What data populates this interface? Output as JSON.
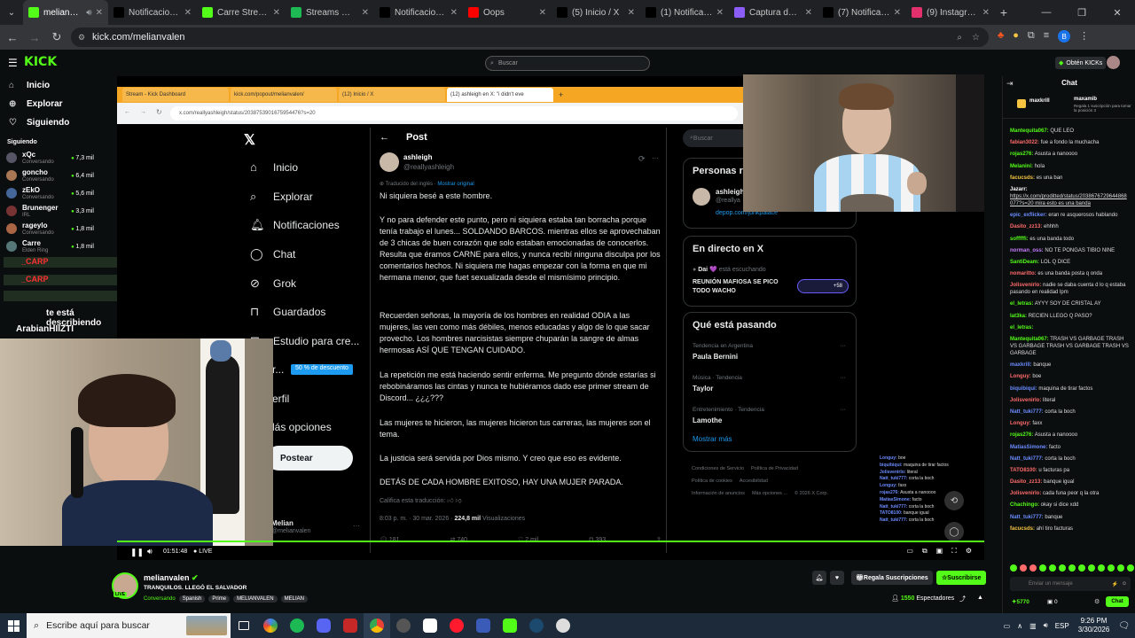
{
  "browser": {
    "tabs": [
      {
        "label": "melianvalen",
        "color": "#53fc18",
        "active": true
      },
      {
        "label": "Notificaciones",
        "color": "#000000"
      },
      {
        "label": "Carre Stream -",
        "color": "#53fc18"
      },
      {
        "label": "Streams — MC",
        "color": "#1db954"
      },
      {
        "label": "Notificaciones",
        "color": "#000000"
      },
      {
        "label": "Oops",
        "color": "#ff0000"
      },
      {
        "label": "(5) Inicio / X",
        "color": "#000000"
      },
      {
        "label": "(1) Notificacion",
        "color": "#000000"
      },
      {
        "label": "Captura de pa",
        "color": "#8b5cf6"
      },
      {
        "label": "(7) Notificacion",
        "color": "#000000"
      },
      {
        "label": "(9) Instagram",
        "color": "#e1306c"
      }
    ],
    "url": "kick.com/melianvalen"
  },
  "kick": {
    "search_placeholder": "Buscar",
    "obtain_kicks": "Obtén KICKs",
    "nav": [
      {
        "label": "Inicio",
        "icon": "home-icon"
      },
      {
        "label": "Explorar",
        "icon": "compass-icon"
      },
      {
        "label": "Siguiendo",
        "icon": "heart-icon"
      }
    ],
    "following_header": "Siguiendo",
    "following": [
      {
        "name": "xQc",
        "game": "Conversando",
        "viewers": "7,3 mil"
      },
      {
        "name": "goncho",
        "game": "Conversando",
        "viewers": "6,4 mil"
      },
      {
        "name": "zEkO",
        "game": "Conversando",
        "viewers": "5,6 mil"
      },
      {
        "name": "Brunenger",
        "game": "IRL",
        "viewers": "3,3 mil"
      },
      {
        "name": "rageylo",
        "game": "Conversando",
        "viewers": "1,8 mil"
      },
      {
        "name": "Carre",
        "game": "Elden Ring",
        "viewers": "1,8 mil"
      }
    ]
  },
  "overlay": {
    "alerts": [
      "_CARP",
      "_CARP"
    ],
    "line1": "te está describiendo",
    "line2": "ArabianHIIZTI"
  },
  "inner_browser": {
    "tabs": [
      "Stream - Kick Dashboard",
      "kick.com/popout/melianvalen/",
      "(12) Inicio / X",
      "(12) ashleigh en X: \"i didn't eve"
    ],
    "url": "x.com/reallyashleigh/status/2038753901675954476?s=20"
  },
  "x_nav": [
    "Inicio",
    "Explorar",
    "Notificaciones",
    "Chat",
    "Grok",
    "Guardados",
    "Estudio para cre...",
    "r...",
    "erfil",
    "lás opciones"
  ],
  "x_premium_badge": "50 % de descuento",
  "x_post_button": "Postear",
  "x_account": {
    "name": "Melian",
    "handle": "@melianvalen"
  },
  "post": {
    "header": "Post",
    "author_name": "ashleigh",
    "author_handle": "@reallyashleigh",
    "translated": "Traducido del inglés",
    "show_original": "Mostrar original",
    "paragraphs": [
      "Ni siquiera besé a este hombre.",
      "Y no para defender este punto, pero ni siquiera estaba tan borracha porque tenía trabajo el lunes... SOLDANDO BARCOS. mientras ellos se aprovechaban de 3 chicas de buen corazón que solo estaban emocionadas de conocerlos. Resulta que éramos CARNE para ellos, y nunca recibí ninguna disculpa por los comentarios hechos. Ni siquiera me hagas empezar con la forma en que mi hermana menor, que fuet sexualizada desde el mismísimo principio.",
      "Recuerden señoras, la mayoría de los hombres en realidad ODIA a las mujeres, las ven como más débiles, menos educadas y algo de lo que sacar provecho. Los hombres narcisistas siempre chuparán la sangre de almas hermosas ASÍ QUE TENGAN CUIDADO.",
      "La repetición me está haciendo sentir enferma. Me pregunto dónde estarías si rebobináramos las cintas y nunca te hubiéramos dado ese primer stream de Discord... ¿¿¿???",
      "Las mujeres te hicieron, las mujeres hicieron tus carreras, las mujeres son el tema.",
      "La justicia será servida por Dios mismo. Y creo que eso es evidente.",
      "DETÁS DE CADA HOMBRE EXITOSO, HAY UNA MUJER PARADA."
    ],
    "rate_translation": "Califica esta traducción:",
    "time": "8:03 p. m. · 30 mar. 2026 ·",
    "views_count": "224,8 mil",
    "views_label": "Visualizaciones",
    "replies": "181",
    "reposts": "740",
    "likes": "2 mil",
    "bookmarks": "393"
  },
  "x_right": {
    "search": "Buscar",
    "people_title": "Personas r",
    "person_name": "ashleigh",
    "person_handle": "@reallya",
    "person_link": "depop.com/junkpalace",
    "live_title": "En directo en X",
    "live_host": "Dai 💜",
    "live_host_suffix": "está escuchando",
    "live_space": "REUNIÓN MAFIOSA SE PICO TODO WACHO",
    "live_count": "+58",
    "trending_title": "Qué está pasando",
    "trends": [
      {
        "context": "Tendencia en Argentina",
        "topic": "Paula Bernini"
      },
      {
        "context": "Música · Tendencia",
        "topic": "Taylor"
      },
      {
        "context": "Entretenimiento · Tendencia",
        "topic": "Lamothe"
      }
    ],
    "show_more": "Mostrar más",
    "footer": [
      "Condiciones de Servicio",
      "Política de Privacidad",
      "Política de cookies",
      "Accesibilidad",
      "Información de anuncios",
      "Más opciones ...",
      "© 2026 X Corp."
    ]
  },
  "mini_chat": [
    {
      "user": "Longuy:",
      "msg": "boe"
    },
    {
      "user": "biquibiqui:",
      "msg": "maquina de tirar factos"
    },
    {
      "user": "Jolisvenirlo:",
      "msg": "literal"
    },
    {
      "user": "Natt_tuki777:",
      "msg": "corta la boch"
    },
    {
      "user": "Longuy:",
      "msg": "faxx"
    },
    {
      "user": "rojas276:",
      "msg": "Asusta a nanoooo"
    },
    {
      "user": "MatiasSimone:",
      "msg": "facto"
    },
    {
      "user": "Natt_tuki777:",
      "msg": "corta la boch"
    },
    {
      "user": "TATO8100:",
      "msg": "banque igual"
    },
    {
      "user": "Natt_tuki777:",
      "msg": "corta la boch"
    }
  ],
  "player": {
    "time": "01:51:48",
    "live": "LIVE"
  },
  "channel": {
    "name": "melianvalen",
    "title": "TRANQUILOS. LLEGÓ EL SALVADOR",
    "category": "Conversando",
    "tags": [
      "Spanish",
      "Prime",
      "MELIANVALEN",
      "MELIAN"
    ],
    "gift_subs": "Regala Suscripciones",
    "subscribe": "Suscribirse",
    "viewers": "1550",
    "viewers_label": "Espectadores"
  },
  "chat": {
    "title": "Chat",
    "pinned_user": "maxkrill",
    "pinned_user2": "maxamib",
    "pinned_sub": "Regala 1 suscripción para tomar la posición 3",
    "messages": [
      {
        "user": "Mantequita067:",
        "msg": "QUE LEO",
        "color": "#53fc18"
      },
      {
        "user": "fabian3022:",
        "msg": "fue a fondo la muchacha",
        "color": "#ff6b6b"
      },
      {
        "user": "rojas276:",
        "msg": "Asusta a nanoooo",
        "color": "#53fc18"
      },
      {
        "user": "Melanini:",
        "msg": "hola",
        "color": "#53fc18"
      },
      {
        "user": "facucsds:",
        "msg": "es una ban",
        "color": "#f5c542"
      },
      {
        "user": "Jazarr:",
        "msg": "https://x.com/proditted/status/2038676729644868077?s=20 mira esto es una banda",
        "color": "#ffffff"
      },
      {
        "user": "epic_exflicker:",
        "msg": "eran re asquerosos hablando",
        "color": "#6b8cff"
      },
      {
        "user": "Dasito_zz13:",
        "msg": "ehhhh",
        "color": "#ff6b6b"
      },
      {
        "user": "sofffffi:",
        "msg": "es una banda todo",
        "color": "#53fc18"
      },
      {
        "user": "norman_oss:",
        "msg": "NO TE PONGAS TIBIO NINE",
        "color": "#c77dff"
      },
      {
        "user": "SantiDeam:",
        "msg": "LOL Q DICE",
        "color": "#53fc18"
      },
      {
        "user": "nomaritto:",
        "msg": "es una banda posta q onda",
        "color": "#ff6b6b"
      },
      {
        "user": "Jolisvenirlo:",
        "msg": "nadie se daba cuenta d lo q estaba pasando en realidad lpm",
        "color": "#ff6b6b"
      },
      {
        "user": "el_letras:",
        "msg": "AYYY SOY DE CRISTAL AY",
        "color": "#53fc18"
      },
      {
        "user": "lat3ka:",
        "msg": "RECIEN LLEGO Q PASO?",
        "color": "#53fc18"
      },
      {
        "user": "el_letras:",
        "msg": "",
        "color": "#53fc18"
      },
      {
        "user": "Mantequita067:",
        "msg": "TRASH VS GARBAGE TRASH VS GARBAGE TRASH VS GARBAGE TRASH VS GARBAGE",
        "color": "#53fc18"
      },
      {
        "user": "maxkrill:",
        "msg": "banque",
        "color": "#6b8cff"
      },
      {
        "user": "Longuy:",
        "msg": "boe",
        "color": "#ff6b6b"
      },
      {
        "user": "biquibiqui:",
        "msg": "maquina de tirar factos",
        "color": "#6b8cff"
      },
      {
        "user": "Jolisvenirlo:",
        "msg": "literal",
        "color": "#ff6b6b"
      },
      {
        "user": "Natt_tuki777:",
        "msg": "corta la boch",
        "color": "#6b8cff"
      },
      {
        "user": "Longuy:",
        "msg": "faxx",
        "color": "#ff6b6b"
      },
      {
        "user": "rojas276:",
        "msg": "Asusta a nanoooo",
        "color": "#53fc18"
      },
      {
        "user": "MatiasSimone:",
        "msg": "facto",
        "color": "#6b8cff"
      },
      {
        "user": "Natt_tuki777:",
        "msg": "corta la boch",
        "color": "#6b8cff"
      },
      {
        "user": "TATO8100:",
        "msg": "u facturas pa",
        "color": "#ff6b6b"
      },
      {
        "user": "Dasito_zz13:",
        "msg": "banque igual",
        "color": "#ff6b6b"
      },
      {
        "user": "Jolisvenirlo:",
        "msg": "cada funa peor q la otra",
        "color": "#ff6b6b"
      },
      {
        "user": "Chachingo:",
        "msg": "okay si dice xdd",
        "color": "#53fc18"
      },
      {
        "user": "Natt_tuki777:",
        "msg": "banque",
        "color": "#6b8cff"
      },
      {
        "user": "facucsds:",
        "msg": "ahí tiro facturas",
        "color": "#f5c542"
      }
    ],
    "input_placeholder": "Enviar un mensaje",
    "kicks_balance": "5770",
    "zero": "0",
    "send": "Chat"
  },
  "taskbar": {
    "search_placeholder": "Escribe aquí para buscar",
    "lang": "ESP",
    "time": "9:26 PM",
    "date": "3/30/2026"
  }
}
